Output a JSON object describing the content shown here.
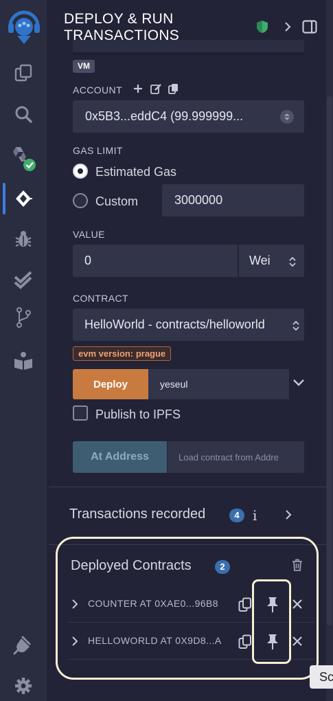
{
  "panel": {
    "title_line1": "DEPLOY & RUN",
    "title_line2": "TRANSACTIONS"
  },
  "environment": {
    "badge": "VM"
  },
  "account": {
    "label": "ACCOUNT",
    "value": "0x5B3...eddC4 (99.999999..."
  },
  "gas_limit": {
    "label": "GAS LIMIT",
    "options": [
      "Estimated Gas",
      "Custom"
    ],
    "selected": "Estimated Gas",
    "custom_value": "3000000"
  },
  "value_field": {
    "label": "VALUE",
    "amount": "0",
    "unit": "Wei"
  },
  "contract": {
    "label": "CONTRACT",
    "selected": "HelloWorld - contracts/helloworld",
    "evm_badge": "evm version: prague"
  },
  "deploy": {
    "button": "Deploy",
    "args": "yeseul",
    "publish_label": "Publish to IPFS"
  },
  "at_address": {
    "button": "At Address",
    "placeholder": "Load contract from Addre"
  },
  "transactions": {
    "label": "Transactions recorded",
    "count": "4",
    "info": "i"
  },
  "deployed": {
    "label": "Deployed Contracts",
    "count": "2",
    "items": [
      {
        "name": "COUNTER AT 0XAE0...96B8"
      },
      {
        "name": "HELLOWORLD AT 0X9D8...A"
      }
    ]
  },
  "tooltip": {
    "text": "Sc"
  },
  "icons": {
    "rail": [
      "remix-logo-icon",
      "file-explorer-icon",
      "search-icon",
      "solidity-compiler-icon",
      "deploy-run-icon",
      "debugger-icon",
      "testing-icon",
      "git-icon",
      "learn-icon",
      "plugin-manager-icon",
      "settings-icon"
    ]
  },
  "colors": {
    "accent_blue": "#3d7de0",
    "deploy_orange": "#c97b3f",
    "at_address_blue": "#3e5d73",
    "badge_blue": "#3a6fb0",
    "highlight": "#f7f0d2"
  }
}
